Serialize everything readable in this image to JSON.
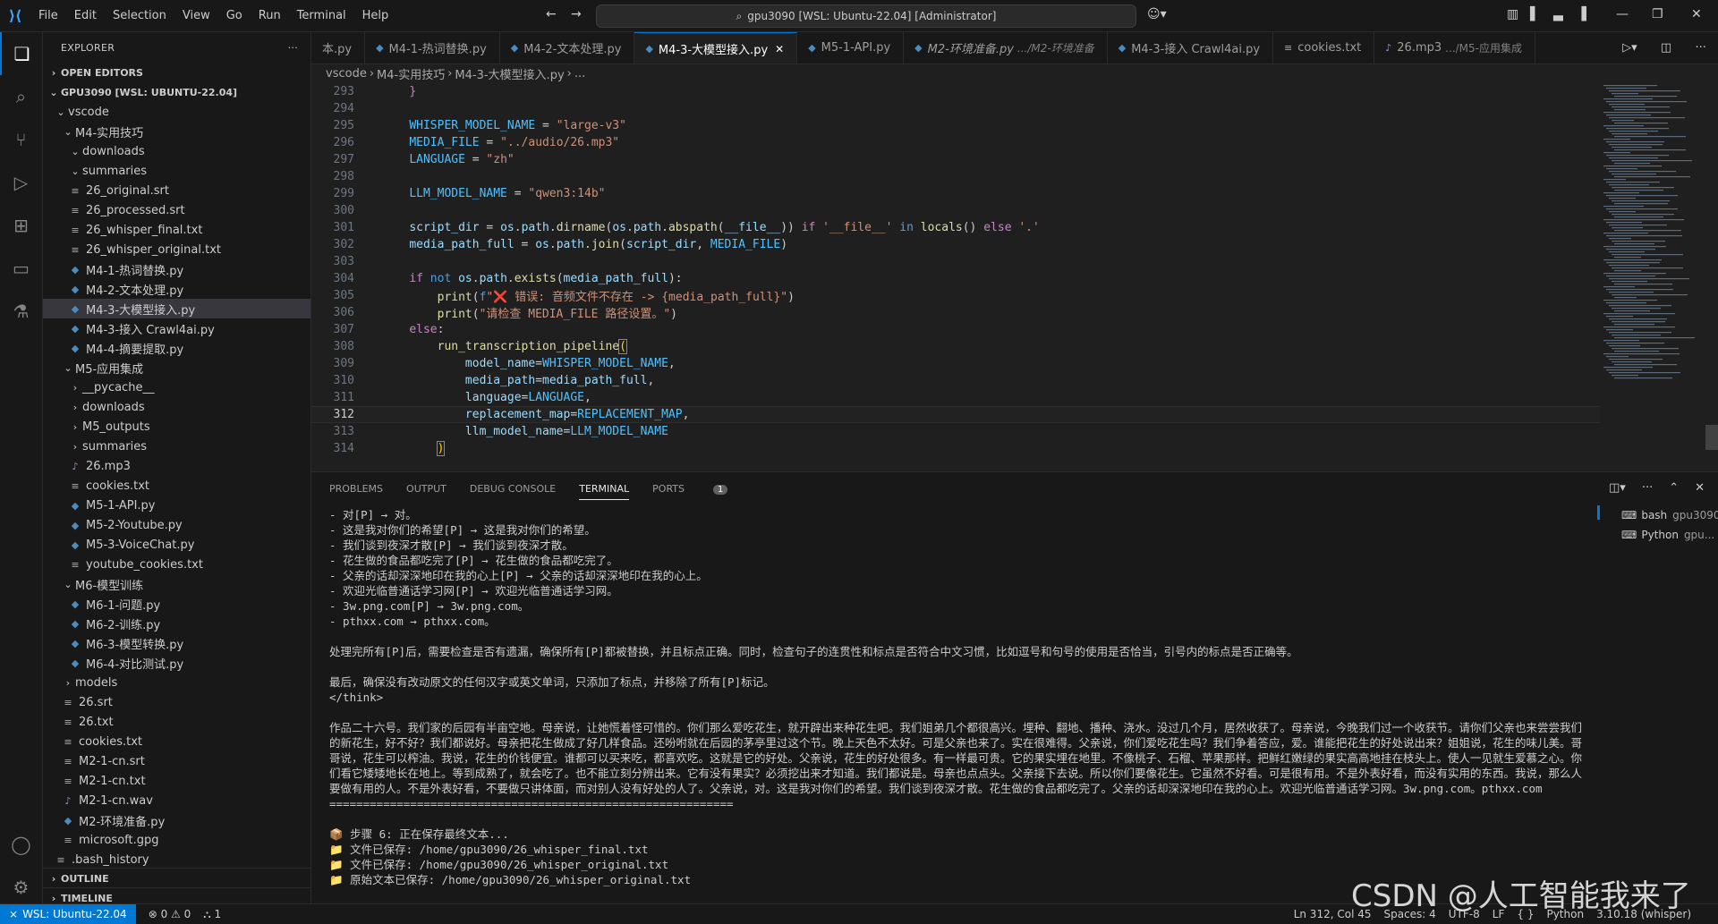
{
  "menu": [
    "File",
    "Edit",
    "Selection",
    "View",
    "Go",
    "Run",
    "Terminal",
    "Help"
  ],
  "command_center": "gpu3090 [WSL: Ubuntu-22.04] [Administrator]",
  "explorer": {
    "title": "EXPLORER",
    "open_editors": "OPEN EDITORS",
    "workspace": "GPU3090 [WSL: UBUNTU-22.04]",
    "outline": "OUTLINE",
    "timeline": "TIMELINE",
    "tree": [
      {
        "label": "vscode",
        "type": "folder-open",
        "indent": 1
      },
      {
        "label": "M4-实用技巧",
        "type": "folder-open",
        "indent": 2
      },
      {
        "label": "downloads",
        "type": "folder-open",
        "indent": 3
      },
      {
        "label": "summaries",
        "type": "folder-open",
        "indent": 3
      },
      {
        "label": "26_original.srt",
        "type": "txt",
        "indent": 3
      },
      {
        "label": "26_processed.srt",
        "type": "txt",
        "indent": 3
      },
      {
        "label": "26_whisper_final.txt",
        "type": "txt",
        "indent": 3
      },
      {
        "label": "26_whisper_original.txt",
        "type": "txt",
        "indent": 3
      },
      {
        "label": "M4-1-热词替换.py",
        "type": "py",
        "indent": 3
      },
      {
        "label": "M4-2-文本处理.py",
        "type": "py",
        "indent": 3
      },
      {
        "label": "M4-3-大模型接入.py",
        "type": "py",
        "indent": 3,
        "selected": true
      },
      {
        "label": "M4-3-接入 Crawl4ai.py",
        "type": "py",
        "indent": 3
      },
      {
        "label": "M4-4-摘要提取.py",
        "type": "py",
        "indent": 3
      },
      {
        "label": "M5-应用集成",
        "type": "folder-open",
        "indent": 2
      },
      {
        "label": "__pycache__",
        "type": "folder",
        "indent": 3
      },
      {
        "label": "downloads",
        "type": "folder",
        "indent": 3
      },
      {
        "label": "M5_outputs",
        "type": "folder",
        "indent": 3
      },
      {
        "label": "summaries",
        "type": "folder",
        "indent": 3
      },
      {
        "label": "26.mp3",
        "type": "mp3",
        "indent": 3
      },
      {
        "label": "cookies.txt",
        "type": "txt",
        "indent": 3
      },
      {
        "label": "M5-1-API.py",
        "type": "py",
        "indent": 3
      },
      {
        "label": "M5-2-Youtube.py",
        "type": "py",
        "indent": 3
      },
      {
        "label": "M5-3-VoiceChat.py",
        "type": "py",
        "indent": 3
      },
      {
        "label": "youtube_cookies.txt",
        "type": "txt",
        "indent": 3
      },
      {
        "label": "M6-模型训练",
        "type": "folder-open",
        "indent": 2
      },
      {
        "label": "M6-1-问题.py",
        "type": "py",
        "indent": 3
      },
      {
        "label": "M6-2-训练.py",
        "type": "py",
        "indent": 3
      },
      {
        "label": "M6-3-模型转换.py",
        "type": "py",
        "indent": 3
      },
      {
        "label": "M6-4-对比测试.py",
        "type": "py",
        "indent": 3
      },
      {
        "label": "models",
        "type": "folder",
        "indent": 2
      },
      {
        "label": "26.srt",
        "type": "txt",
        "indent": 2
      },
      {
        "label": "26.txt",
        "type": "txt",
        "indent": 2
      },
      {
        "label": "cookies.txt",
        "type": "txt",
        "indent": 2
      },
      {
        "label": "M2-1-cn.srt",
        "type": "txt",
        "indent": 2
      },
      {
        "label": "M2-1-cn.txt",
        "type": "txt",
        "indent": 2
      },
      {
        "label": "M2-1-cn.wav",
        "type": "mp3",
        "indent": 2
      },
      {
        "label": "M2-环境准备.py",
        "type": "py",
        "indent": 2
      },
      {
        "label": "microsoft.gpg",
        "type": "txt",
        "indent": 2
      },
      {
        "label": ".bash_history",
        "type": "txt",
        "indent": 1
      }
    ]
  },
  "tabs": [
    {
      "label": "本.py",
      "icon": "py"
    },
    {
      "label": "M4-1-热词替换.py",
      "icon": "py"
    },
    {
      "label": "M4-2-文本处理.py",
      "icon": "py"
    },
    {
      "label": "M4-3-大模型接入.py",
      "icon": "py",
      "active": true
    },
    {
      "label": "M5-1-API.py",
      "icon": "py"
    },
    {
      "label": "M2-环境准备.py",
      "icon": "py",
      "desc": ".../M2-环境准备",
      "italic": true
    },
    {
      "label": "M4-3-接入 Crawl4ai.py",
      "icon": "py"
    },
    {
      "label": "cookies.txt",
      "icon": "txt"
    },
    {
      "label": "26.mp3",
      "icon": "mp3",
      "desc": ".../M5-应用集成"
    }
  ],
  "breadcrumb": [
    "vscode",
    "M4-实用技巧",
    "M4-3-大模型接入.py",
    "..."
  ],
  "code": {
    "lines": [
      "293",
      "294",
      "295",
      "296",
      "297",
      "298",
      "299",
      "300",
      "301",
      "302",
      "303",
      "304",
      "305",
      "306",
      "307",
      "308",
      "309",
      "310",
      "311",
      "312",
      "313",
      "314"
    ],
    "current_line": "312",
    "l293": "}",
    "whisper_var": "WHISPER_MODEL_NAME",
    "whisper_val": "\"large-v3\"",
    "media_var": "MEDIA_FILE",
    "media_val": "\"../audio/26.mp3\"",
    "lang_var": "LANGUAGE",
    "lang_val": "\"zh\"",
    "llm_var": "LLM_MODEL_NAME",
    "llm_val": "\"qwen3:14b\"",
    "l305_str": "\"❌ 错误: 音频文件不存在 -> {media_path_full}\"",
    "l306_str": "\"请检查 MEDIA_FILE 路径设置。\""
  },
  "panel": {
    "tabs": [
      "PROBLEMS",
      "OUTPUT",
      "DEBUG CONSOLE",
      "TERMINAL",
      "PORTS"
    ],
    "ports_badge": "1",
    "terminals": [
      {
        "name": "bash",
        "sub": "gpu3090"
      },
      {
        "name": "Python",
        "sub": "gpu..."
      }
    ]
  },
  "terminal": {
    "lines1": [
      "- 对[P] → 对。",
      "- 这是我对你们的希望[P] → 这是我对你们的希望。",
      "- 我们谈到夜深才散[P] → 我们谈到夜深才散。",
      "- 花生做的食品都吃完了[P] → 花生做的食品都吃完了。",
      "- 父亲的话却深深地印在我的心上[P] → 父亲的话却深深地印在我的心上。",
      "- 欢迎光临普通话学习网[P] → 欢迎光临普通话学习网。",
      "- 3w.png.com[P] → 3w.png.com。",
      "- pthxx.com → pthxx.com。"
    ],
    "para1": "处理完所有[P]后，需要检查是否有遗漏，确保所有[P]都被替换，并且标点正确。同时，检查句子的连贯性和标点是否符合中文习惯，比如逗号和句号的使用是否恰当，引号内的标点是否正确等。",
    "para2": "最后，确保没有改动原文的任何汉字或英文单词，只添加了标点，并移除了所有[P]标记。",
    "think_end": "</think>",
    "para3": "作品二十六号。我们家的后园有半亩空地。母亲说，让她慌着怪可惜的。你们那么爱吃花生，就开辟出来种花生吧。我们姐弟几个都很高兴。埋种、翻地、播种、浇水。没过几个月，居然收获了。母亲说，今晚我们过一个收获节。请你们父亲也来尝尝我们的新花生，好不好？我们都说好。母亲把花生做成了好几样食品。还吩咐就在后园的茅亭里过这个节。晚上天色不太好。可是父亲也来了。实在很难得。父亲说，你们爱吃花生吗？我们争着答应，爱。谁能把花生的好处说出来？姐姐说，花生的味儿美。哥哥说，花生可以榨油。我说，花生的价钱便宜。谁都可以买来吃，都喜欢吃。这就是它的好处。父亲说，花生的好处很多。有一样最可贵。它的果实埋在地里。不像桃子、石榴、苹果那样。把鲜红嫩绿的果实高高地挂在枝头上。使人一见就生爱慕之心。你们看它矮矮地长在地上。等到成熟了，就会吃了。也不能立刻分辨出来。它有没有果实？必须挖出来才知道。我们都说是。母亲也点点头。父亲接下去说。所以你们要像花生。它虽然不好看。可是很有用。不是外表好看，而没有实用的东西。我说，那么人要做有用的人。不是外表好看，不要做只讲体面，而对别人没有好处的人了。父亲说，对。这是我对你们的希望。我们谈到夜深才散。花生做的食品都吃完了。父亲的话却深深地印在我的心上。欢迎光临普通话学习网。3w.png.com。pthxx.com",
    "separator": "============================================================",
    "step6": "📦 步骤 6: 正在保存最终文本...",
    "saved1": "📁 文件已保存: /home/gpu3090/26_whisper_final.txt",
    "saved2": "📁 文件已保存: /home/gpu3090/26_whisper_original.txt",
    "saved3": "📁 原始文本已保存: /home/gpu3090/26_whisper_original.txt"
  },
  "status": {
    "remote": "WSL: Ubuntu-22.04",
    "problems": "⊗ 0 ⚠ 0",
    "ports": "⛬ 1",
    "position": "Ln 312, Col 45",
    "spaces": "Spaces: 4",
    "encoding": "UTF-8",
    "eol": "LF",
    "lang_braces": "{ }",
    "language": "Python",
    "interpreter": "3.10.18 (whisper)"
  },
  "watermark": "CSDN @人工智能我来了"
}
